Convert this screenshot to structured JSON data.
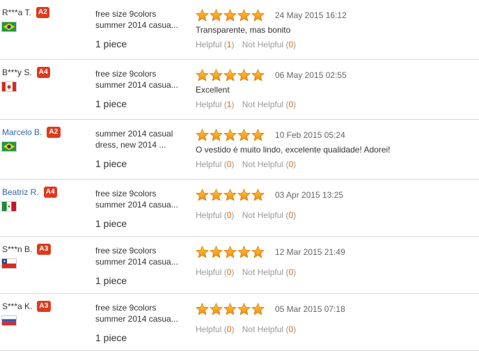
{
  "colors": {
    "badge": "#dd3b1f",
    "star": "#f7a11a",
    "link_name": "#3366aa",
    "helpful_count": "#e56600",
    "divider": "#d9d9d9"
  },
  "reviews": [
    {
      "buyer": "R***a T.",
      "name_is_link": false,
      "level": "A2",
      "country_flag": "brazil-flag",
      "product": "free size 9colors summer 2014 casua...",
      "quantity": "1 piece",
      "stars": 5,
      "date": "24 May 2015 16:12",
      "comment": "Transparente, mas bonito",
      "helpful_label": "Helpful",
      "helpful_count": "1",
      "not_helpful_label": "Not Helpful",
      "not_helpful_count": "0"
    },
    {
      "buyer": "B***y S.",
      "name_is_link": false,
      "level": "A4",
      "country_flag": "canada-flag",
      "product": "free size 9colors summer 2014 casua...",
      "quantity": "1 piece",
      "stars": 5,
      "date": "06 May 2015 02:55",
      "comment": "Excellent",
      "helpful_label": "Helpful",
      "helpful_count": "1",
      "not_helpful_label": "Not Helpful",
      "not_helpful_count": "0"
    },
    {
      "buyer": "Marcelo B.",
      "name_is_link": true,
      "level": "A2",
      "country_flag": "brazil-flag",
      "product": "summer 2014 casual dress, new 2014 ...",
      "quantity": "1 piece",
      "stars": 5,
      "date": "10 Feb 2015 05:24",
      "comment": "O vestido é muito lindo, excelente qualidade! Adorei!",
      "helpful_label": "Helpful",
      "helpful_count": "0",
      "not_helpful_label": "Not Helpful",
      "not_helpful_count": "0"
    },
    {
      "buyer": "Beatriz R.",
      "name_is_link": true,
      "level": "A4",
      "country_flag": "mexico-flag",
      "product": "free size 9colors summer 2014 casua...",
      "quantity": "1 piece",
      "stars": 5,
      "date": "03 Apr 2015 13:25",
      "comment": "",
      "helpful_label": "Helpful",
      "helpful_count": "0",
      "not_helpful_label": "Not Helpful",
      "not_helpful_count": "0"
    },
    {
      "buyer": "S***n B.",
      "name_is_link": false,
      "level": "A3",
      "country_flag": "chile-flag",
      "product": "free size 9colors summer 2014 casua...",
      "quantity": "1 piece",
      "stars": 5,
      "date": "12 Mar 2015 21:49",
      "comment": "",
      "helpful_label": "Helpful",
      "helpful_count": "0",
      "not_helpful_label": "Not Helpful",
      "not_helpful_count": "0"
    },
    {
      "buyer": "S***a K.",
      "name_is_link": false,
      "level": "A3",
      "country_flag": "russia-flag",
      "product": "free size 9colors summer 2014 casua...",
      "quantity": "1 piece",
      "stars": 5,
      "date": "05 Mar 2015 07:18",
      "comment": "",
      "helpful_label": "Helpful",
      "helpful_count": "0",
      "not_helpful_label": "Not Helpful",
      "not_helpful_count": "0"
    }
  ]
}
